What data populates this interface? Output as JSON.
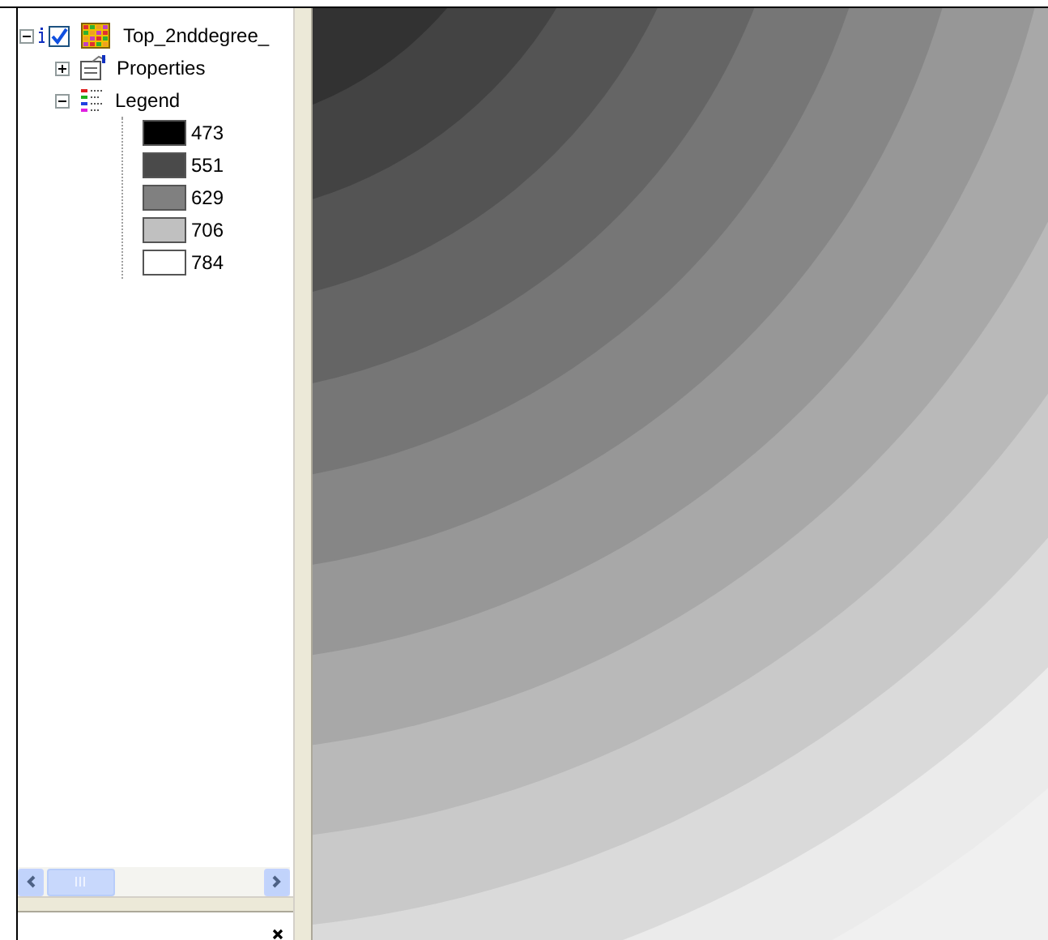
{
  "layer": {
    "name": "Top_2nddegree_",
    "expanded": true,
    "visible": true,
    "children": [
      {
        "kind": "properties",
        "label": "Properties",
        "expanded": false
      },
      {
        "kind": "legend",
        "label": "Legend",
        "expanded": true,
        "classes": [
          {
            "label": "473",
            "color": "#000000"
          },
          {
            "label": "551",
            "color": "#4a4a4a"
          },
          {
            "label": "629",
            "color": "#808080"
          },
          {
            "label": "706",
            "color": "#c0c0c0"
          },
          {
            "label": "784",
            "color": "#ffffff"
          }
        ]
      }
    ]
  }
}
